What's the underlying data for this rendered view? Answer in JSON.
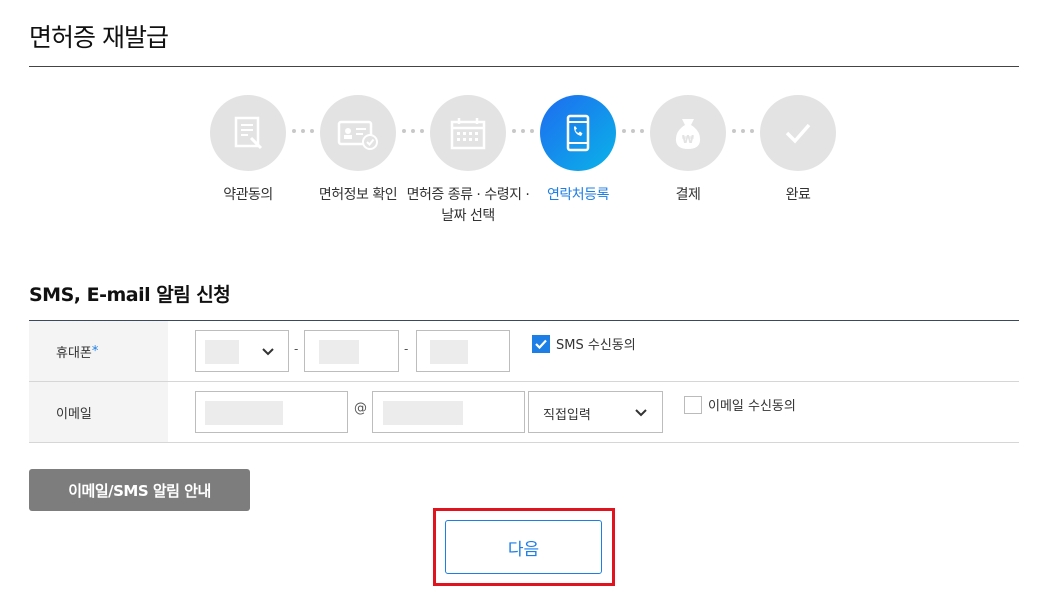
{
  "page": {
    "title": "면허증 재발급"
  },
  "steps": [
    {
      "label": "약관동의",
      "icon": "document-edit-icon",
      "active": false
    },
    {
      "label": "면허정보 확인",
      "icon": "id-card-check-icon",
      "active": false
    },
    {
      "label": "면허증 종류 · 수령지 · 날짜 선택",
      "icon": "calendar-icon",
      "active": false
    },
    {
      "label": "연락처등록",
      "icon": "mobile-phone-icon",
      "active": true
    },
    {
      "label": "결제",
      "icon": "won-money-bag-icon",
      "active": false
    },
    {
      "label": "완료",
      "icon": "check-icon",
      "active": false
    }
  ],
  "section": {
    "title": "SMS, E-mail 알림 신청"
  },
  "form": {
    "phone": {
      "label": "휴대폰",
      "required_mark": "*",
      "dash": "-",
      "consent_label": "SMS 수신동의",
      "consent_checked": true
    },
    "email": {
      "label": "이메일",
      "at": "@",
      "domain_select": "직접입력",
      "consent_label": "이메일 수신동의",
      "consent_checked": false
    }
  },
  "buttons": {
    "notice": "이메일/SMS 알림 안내",
    "next": "다음"
  },
  "colors": {
    "accent": "#1d7ee6",
    "highlight": "#e0141e",
    "inactive_step": "#e3e3e3"
  }
}
